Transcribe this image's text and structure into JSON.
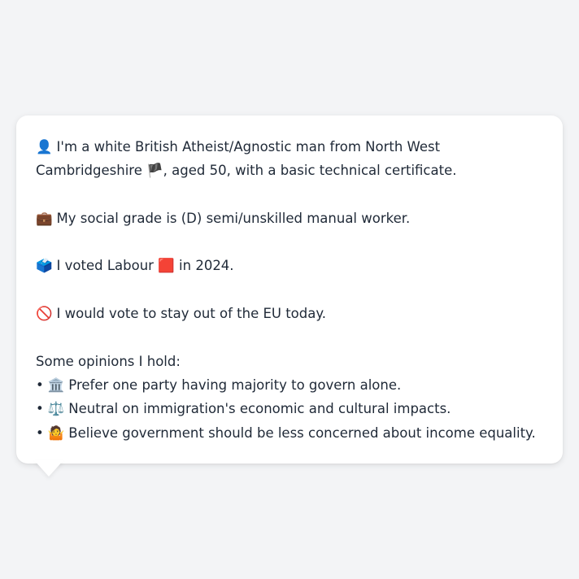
{
  "card": {
    "identity": {
      "icon": "👤",
      "text_before_flag": "I'm a white British Atheist/Agnostic man from North West Cambridgeshire",
      "flag": "🏴",
      "text_after_flag": ", aged 50, with a basic technical certificate."
    },
    "social_grade": {
      "icon": "💼",
      "text": "My social grade is (D) semi/unskilled manual worker."
    },
    "vote": {
      "icon": "🗳️",
      "text_before": "I voted Labour",
      "party_color_icon": "🟥",
      "text_after": "in 2024."
    },
    "eu": {
      "icon": "🚫",
      "text": "I would vote to stay out of the EU today."
    },
    "opinions_heading": "Some opinions I hold:",
    "opinions": [
      {
        "bullet": "•",
        "icon": "🏛️",
        "text": "Prefer one party having majority to govern alone."
      },
      {
        "bullet": "•",
        "icon": "⚖️",
        "text": "Neutral on immigration's economic and cultural impacts."
      },
      {
        "bullet": "•",
        "icon": "🤷",
        "text": "Believe government should be less concerned about income equality."
      }
    ]
  }
}
